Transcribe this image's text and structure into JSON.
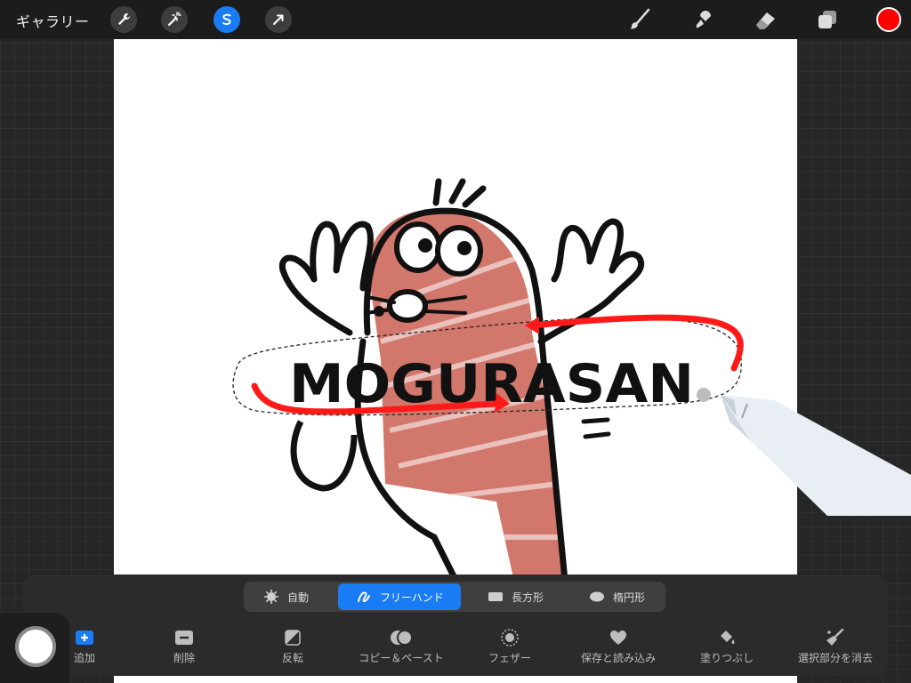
{
  "toolbar": {
    "gallery_label": "ギャラリー",
    "left_tools": [
      "wrench-icon",
      "magic-wand-icon",
      "selection-icon",
      "transform-arrow-icon"
    ],
    "active_tool": "selection-icon",
    "right_tools": [
      "brush-icon",
      "smudge-icon",
      "eraser-icon",
      "layers-icon"
    ],
    "current_color": "#ff0000"
  },
  "canvas": {
    "artwork_text": "MOGURASAN",
    "fill_color": "#d2776b",
    "stroke_color": "#ff1a1a"
  },
  "selection_panel": {
    "modes": [
      {
        "label": "自動",
        "icon": "auto-starburst-icon"
      },
      {
        "label": "フリーハンド",
        "icon": "freehand-icon"
      },
      {
        "label": "長方形",
        "icon": "rectangle-icon"
      },
      {
        "label": "楕円形",
        "icon": "ellipse-icon"
      }
    ],
    "active_mode": "フリーハンド",
    "actions": [
      {
        "label": "追加",
        "icon": "add-icon"
      },
      {
        "label": "削除",
        "icon": "remove-icon"
      },
      {
        "label": "反転",
        "icon": "invert-icon"
      },
      {
        "label": "コピー＆ペースト",
        "icon": "copy-paste-icon"
      },
      {
        "label": "フェザー",
        "icon": "feather-icon"
      },
      {
        "label": "保存と読み込み",
        "icon": "heart-icon"
      },
      {
        "label": "塗りつぶし",
        "icon": "fill-bucket-icon"
      },
      {
        "label": "選択部分を消去",
        "icon": "clear-broom-icon"
      }
    ]
  },
  "accent_color": "#1a7cf5"
}
